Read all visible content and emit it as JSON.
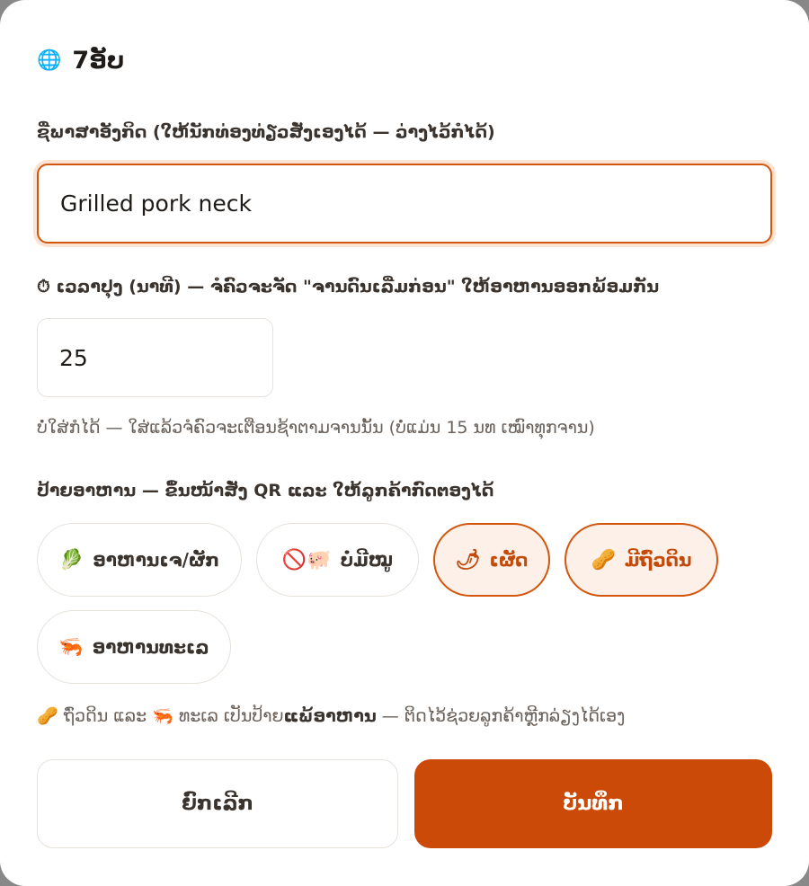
{
  "header": {
    "icon": "globe-icon",
    "icon_glyph": "🌐",
    "title": "7ອັບ"
  },
  "english_name": {
    "label": "ຊື່ພາສາອັງກິດ (ໃຫ້ນັກທ່ອງທ່ຽວສັ່ງເອງໄດ້ — ວ່າງໄວ້ກໍໄດ້)",
    "value": "Grilled pork neck"
  },
  "cook_time": {
    "icon_glyph": "⏱",
    "label": "ເວລາປຸງ (ນາທີ) — ຈໍຄົວຈະຈັດ \"ຈານດົນເລີ່ມກ່ອນ\" ໃຫ້ອາຫານອອກພ້ອມກັນ",
    "value": "25",
    "hint": "ບໍ່ໃສ່ກໍໄດ້ — ໃສ່ແລ້ວຈໍຄົວຈະເຕືອນຊ້າຕາມຈານນັ້ນ (ບໍ່ແມ່ນ 15 ນທ ເໝົາທຸກຈານ)"
  },
  "tags": {
    "label": "ປ້າຍອາຫານ — ຂຶ້ນໜ້າສັ່ງ QR ແລະ ໃຫ້ລູກຄ້າກົດຕອງໄດ້",
    "items": [
      {
        "icon": "leafy-green-icon",
        "glyph": "🥬",
        "label": "ອາຫານເຈ/ຜັກ",
        "selected": false
      },
      {
        "icon": "no-pork-icon",
        "glyph": "🚫🐖",
        "label": "ບໍ່ມີໝູ",
        "selected": false
      },
      {
        "icon": "chili-pepper-icon",
        "glyph": "🌶",
        "label": "ເຜັດ",
        "selected": true
      },
      {
        "icon": "peanut-icon",
        "glyph": "🥜",
        "label": "ມີຖົ່ວດິນ",
        "selected": true
      },
      {
        "icon": "shrimp-icon",
        "glyph": "🦐",
        "label": "ອາຫານທະເລ",
        "selected": false
      }
    ]
  },
  "allergen_note": {
    "peanut_glyph": "🥜",
    "part1": "ຖົ່ວດິນ ແລະ",
    "shrimp_glyph": "🦐",
    "part2": "ທະເລ ເປັນປ້າຍ",
    "bold": "ແພ້ອາຫານ",
    "part3": "— ຕິດໄວ້ຊ່ວຍລູກຄ້າຫຼີກລ່ຽງໄດ້ເອງ"
  },
  "actions": {
    "cancel_label": "ຍົກເລີກ",
    "save_label": "ບັນທຶກ"
  },
  "colors": {
    "accent": "#cc4a08",
    "accent_soft": "#fdf0e8",
    "border": "#e7e2dc"
  }
}
